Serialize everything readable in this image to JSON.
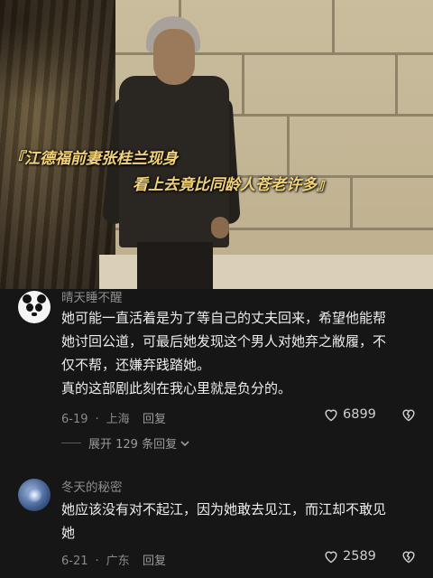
{
  "video": {
    "caption_line1": "『江德福前妻张桂兰现身",
    "caption_line2": "看上去竟比同龄人苍老许多』"
  },
  "comments": [
    {
      "username": "晴天睡不醒",
      "paragraphs": [
        "她可能一直活着是为了等自己的丈夫回来，希望他能帮",
        "她讨回公道，可最后她发现这个男人对她弃之敝履，不",
        "仅不帮，还嫌弃践踏她。",
        "真的这部剧此刻在我心里就是负分的。"
      ],
      "date": "6-19",
      "location": "上海",
      "reply_label": "回复",
      "likes": "6899",
      "expand_label": "展开 129 条回复"
    },
    {
      "username": "冬天的秘密",
      "paragraphs": [
        "她应该没有对不起江，因为她敢去见江，而江却不敢见",
        "她"
      ],
      "date": "6-21",
      "location": "广东",
      "reply_label": "回复",
      "likes": "2589"
    }
  ],
  "separator": "·",
  "icons": {
    "avatar1": "panda-avatar-icon",
    "avatar2": "blue-orb-avatar-icon",
    "like": "heart-outline-icon",
    "dislike": "broken-heart-icon",
    "expand": "chevron-down-icon"
  }
}
